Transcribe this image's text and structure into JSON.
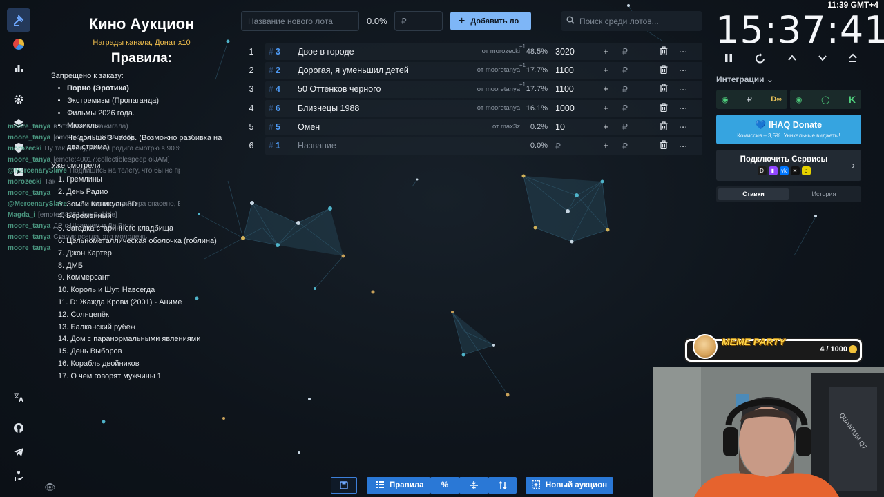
{
  "rules": {
    "title": "Кино Аукцион",
    "subtitle": "Награды канала, Донат x10",
    "heading": "Правила:",
    "prohibited_label": "Запрещено к заказу:",
    "prohibited": [
      {
        "text": "Порно (Эротика)",
        "bold": true
      },
      {
        "text": "Экстремизм (Пропаганда)",
        "bold": false
      },
      {
        "text": "Фильмы 2026 года.",
        "bold": false
      },
      {
        "text": "Мюзиклы",
        "bold": false
      },
      {
        "text": "Не дольше 3 часов. (Возможно разбивка на два стрима)",
        "bold": false
      }
    ],
    "watched_label": "Уже смотрели",
    "watched": [
      "1. Гремлины",
      "2. День Радио",
      "3. Зомби Каникулы 3D",
      "4. Беременный",
      "5. Загадка старинного кладбища",
      "6. Цельнометаллическая оболочка (гоблина)",
      "7. Джон Картер",
      "8. ДМБ",
      "9. Коммерсант",
      "10. Король и Шут. Навсегда",
      "11. D: Жажда Крови (2001) - Аниме",
      "12. Солнцепёк",
      "13. Балканский рубеж",
      "14. Дом с паранормальными явлениями",
      "15. День Выборов",
      "16. Корабль двойников",
      "17. О чем говорят мужчины 1"
    ]
  },
  "chat": [
    {
      "user": "moore_tanya",
      "text": "в этом аваче зажигала)"
    },
    {
      "user": "moore_tanya",
      "text": "[emote:4_5795:ODAJAM]"
    },
    {
      "user": "morozecki",
      "text": "Ну так в хову, тебя и родига смотрю в 90% времени"
    },
    {
      "user": "moore_tanya",
      "text": "[emote:40017:collectiblespeep oiJAM]"
    },
    {
      "user": "@MercenarySlave",
      "text": "Подпишись на телегу, что бы не пропустить ЧТО ЧАЩЕ ХИМА http://t.me/Me"
    },
    {
      "user": "morozecki",
      "text": "Так"
    },
    {
      "user": "moore_tanya",
      "text": ""
    },
    {
      "user": "@MercenarySlave",
      "text": "— сто нервов стримера спасено, Близнецы 1988 — это залет"
    },
    {
      "user": "Magda_i",
      "text": "[emote:58251:beeBobble]"
    },
    {
      "user": "moore_tanya",
      "text": "ДР с Шварцем и Де Вито"
    },
    {
      "user": "moore_tanya",
      "text": "Старик всегда, это молодежь"
    },
    {
      "user": "moore_tanya",
      "text": ""
    }
  ],
  "toolbar": {
    "new_lot_placeholder": "Название нового лота",
    "percent": "0.0%",
    "currency_placeholder": "₽",
    "add_button": "Добавить ло",
    "search_placeholder": "Поиск среди лотов..."
  },
  "lots": [
    {
      "n": "1",
      "id": "3",
      "name": "Двое в городе",
      "from": "от morozecki",
      "sup": "+1",
      "share": "48.5%",
      "amount": "3020",
      "placeholder": false
    },
    {
      "n": "2",
      "id": "2",
      "name": "Дорогая, я уменьшил детей",
      "from": "от mooretanya",
      "sup": "+1",
      "share": "17.7%",
      "amount": "1100",
      "placeholder": false
    },
    {
      "n": "3",
      "id": "4",
      "name": "50 Оттенков черного",
      "from": "от mooretanya",
      "sup": "+1",
      "share": "17.7%",
      "amount": "1100",
      "placeholder": false
    },
    {
      "n": "4",
      "id": "6",
      "name": "Близнецы 1988",
      "from": "от mooretanya",
      "sup": "",
      "share": "16.1%",
      "amount": "1000",
      "placeholder": false
    },
    {
      "n": "5",
      "id": "5",
      "name": "Омен",
      "from": "от max3z",
      "sup": "",
      "share": "0.2%",
      "amount": "10",
      "placeholder": false
    },
    {
      "n": "6",
      "id": "1",
      "name": "Название",
      "from": "",
      "sup": "",
      "share": "0.0%",
      "amount": "₽",
      "placeholder": true
    }
  ],
  "lot_actions": {
    "plus": "+",
    "rub": "₽",
    "trash": "🗑",
    "more": "⋯",
    "hash": "#"
  },
  "right": {
    "clock": "11:39 GMT+4",
    "timer": "15:37:41",
    "integrations_label": "Интеграции",
    "integration_cards": [
      {
        "left": "₽",
        "right": "D∞"
      },
      {
        "left": "◯",
        "right": "K"
      }
    ],
    "donate_title": "IHAQ Donate",
    "donate_sub": "Комиссия – 3,5%. Уникальные виджеты!",
    "services_title": "Подключить Сервисы",
    "tabs": [
      "Ставки",
      "История"
    ]
  },
  "meme_party": {
    "title": "MEME PARTY",
    "count": "4 / 1000"
  },
  "bottom": {
    "rules_button": "Правила",
    "new_auction_button": "Новый аукцион"
  },
  "colors": {
    "accent": "#4e9af4",
    "add_button": "#7eb6f7",
    "donate": "#36a4e0",
    "rail_active": "#24395a"
  }
}
